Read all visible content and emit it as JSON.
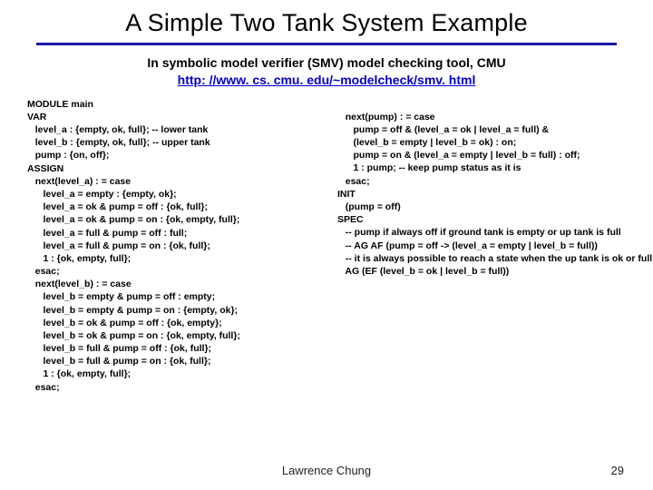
{
  "title": "A Simple Two Tank System Example",
  "intro_line1": "In symbolic model verifier (SMV) model checking tool, CMU",
  "intro_link_text": "http: //www. cs. cmu. edu/~modelcheck/smv. html",
  "intro_link_href": "http://www.cs.cmu.edu/~modelcheck/smv.html",
  "code_left": "MODULE main\nVAR\n   level_a : {empty, ok, full}; -- lower tank\n   level_b : {empty, ok, full}; -- upper tank\n   pump : {on, off};\nASSIGN\n   next(level_a) : = case\n      level_a = empty : {empty, ok};\n      level_a = ok & pump = off : {ok, full};\n      level_a = ok & pump = on : {ok, empty, full};\n      level_a = full & pump = off : full;\n      level_a = full & pump = on : {ok, full};\n      1 : {ok, empty, full};\n   esac;\n   next(level_b) : = case\n      level_b = empty & pump = off : empty;\n      level_b = empty & pump = on : {empty, ok};\n      level_b = ok & pump = off : {ok, empty};\n      level_b = ok & pump = on : {ok, empty, full};\n      level_b = full & pump = off : {ok, full};\n      level_b = full & pump = on : {ok, full};\n      1 : {ok, empty, full};\n   esac;",
  "code_right": "   next(pump) : = case\n      pump = off & (level_a = ok | level_a = full) &\n      (level_b = empty | level_b = ok) : on;\n      pump = on & (level_a = empty | level_b = full) : off;\n      1 : pump; -- keep pump status as it is\n   esac;\nINIT\n   (pump = off)\nSPEC\n   -- pump if always off if ground tank is empty or up tank is full\n   -- AG AF (pump = off -> (level_a = empty | level_b = full))\n   -- it is always possible to reach a state when the up tank is ok or full\n   AG (EF (level_b = ok | level_b = full))",
  "footer_author": "Lawrence Chung",
  "page_number": "29"
}
